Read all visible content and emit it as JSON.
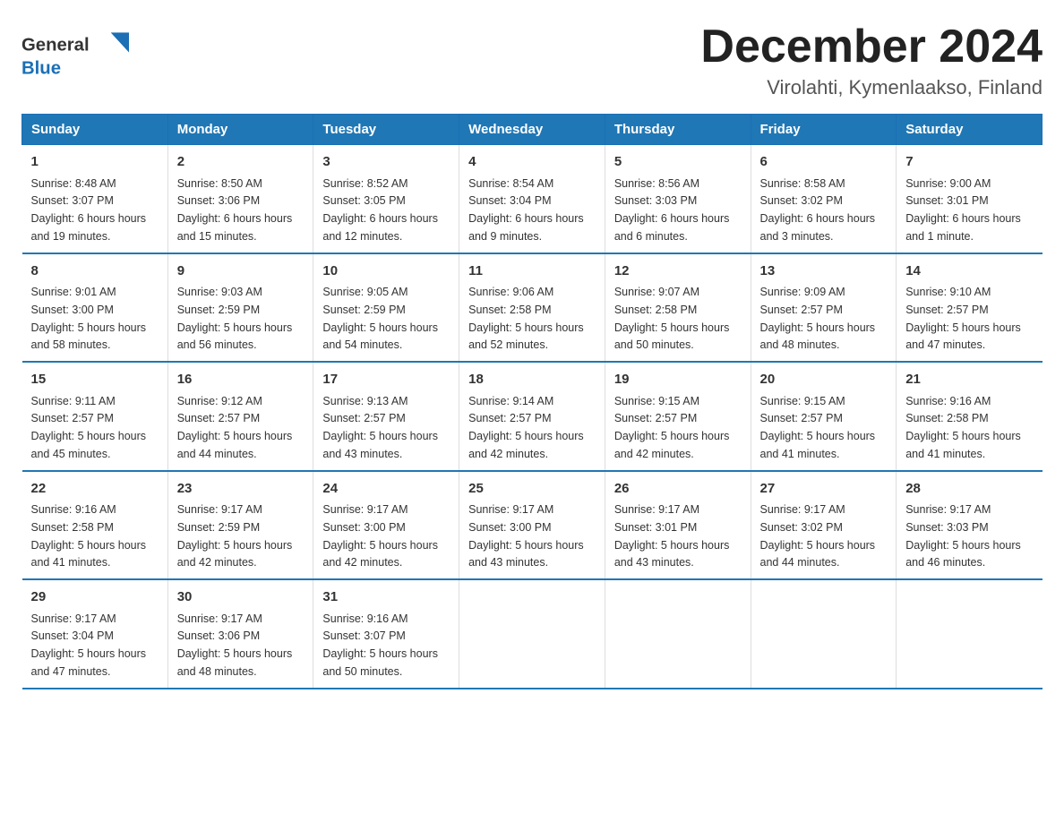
{
  "logo": {
    "general": "General",
    "blue": "Blue"
  },
  "header": {
    "month": "December 2024",
    "location": "Virolahti, Kymenlaakso, Finland"
  },
  "columns": [
    "Sunday",
    "Monday",
    "Tuesday",
    "Wednesday",
    "Thursday",
    "Friday",
    "Saturday"
  ],
  "weeks": [
    [
      {
        "day": "1",
        "sunrise": "8:48 AM",
        "sunset": "3:07 PM",
        "daylight": "6 hours and 19 minutes."
      },
      {
        "day": "2",
        "sunrise": "8:50 AM",
        "sunset": "3:06 PM",
        "daylight": "6 hours and 15 minutes."
      },
      {
        "day": "3",
        "sunrise": "8:52 AM",
        "sunset": "3:05 PM",
        "daylight": "6 hours and 12 minutes."
      },
      {
        "day": "4",
        "sunrise": "8:54 AM",
        "sunset": "3:04 PM",
        "daylight": "6 hours and 9 minutes."
      },
      {
        "day": "5",
        "sunrise": "8:56 AM",
        "sunset": "3:03 PM",
        "daylight": "6 hours and 6 minutes."
      },
      {
        "day": "6",
        "sunrise": "8:58 AM",
        "sunset": "3:02 PM",
        "daylight": "6 hours and 3 minutes."
      },
      {
        "day": "7",
        "sunrise": "9:00 AM",
        "sunset": "3:01 PM",
        "daylight": "6 hours and 1 minute."
      }
    ],
    [
      {
        "day": "8",
        "sunrise": "9:01 AM",
        "sunset": "3:00 PM",
        "daylight": "5 hours and 58 minutes."
      },
      {
        "day": "9",
        "sunrise": "9:03 AM",
        "sunset": "2:59 PM",
        "daylight": "5 hours and 56 minutes."
      },
      {
        "day": "10",
        "sunrise": "9:05 AM",
        "sunset": "2:59 PM",
        "daylight": "5 hours and 54 minutes."
      },
      {
        "day": "11",
        "sunrise": "9:06 AM",
        "sunset": "2:58 PM",
        "daylight": "5 hours and 52 minutes."
      },
      {
        "day": "12",
        "sunrise": "9:07 AM",
        "sunset": "2:58 PM",
        "daylight": "5 hours and 50 minutes."
      },
      {
        "day": "13",
        "sunrise": "9:09 AM",
        "sunset": "2:57 PM",
        "daylight": "5 hours and 48 minutes."
      },
      {
        "day": "14",
        "sunrise": "9:10 AM",
        "sunset": "2:57 PM",
        "daylight": "5 hours and 47 minutes."
      }
    ],
    [
      {
        "day": "15",
        "sunrise": "9:11 AM",
        "sunset": "2:57 PM",
        "daylight": "5 hours and 45 minutes."
      },
      {
        "day": "16",
        "sunrise": "9:12 AM",
        "sunset": "2:57 PM",
        "daylight": "5 hours and 44 minutes."
      },
      {
        "day": "17",
        "sunrise": "9:13 AM",
        "sunset": "2:57 PM",
        "daylight": "5 hours and 43 minutes."
      },
      {
        "day": "18",
        "sunrise": "9:14 AM",
        "sunset": "2:57 PM",
        "daylight": "5 hours and 42 minutes."
      },
      {
        "day": "19",
        "sunrise": "9:15 AM",
        "sunset": "2:57 PM",
        "daylight": "5 hours and 42 minutes."
      },
      {
        "day": "20",
        "sunrise": "9:15 AM",
        "sunset": "2:57 PM",
        "daylight": "5 hours and 41 minutes."
      },
      {
        "day": "21",
        "sunrise": "9:16 AM",
        "sunset": "2:58 PM",
        "daylight": "5 hours and 41 minutes."
      }
    ],
    [
      {
        "day": "22",
        "sunrise": "9:16 AM",
        "sunset": "2:58 PM",
        "daylight": "5 hours and 41 minutes."
      },
      {
        "day": "23",
        "sunrise": "9:17 AM",
        "sunset": "2:59 PM",
        "daylight": "5 hours and 42 minutes."
      },
      {
        "day": "24",
        "sunrise": "9:17 AM",
        "sunset": "3:00 PM",
        "daylight": "5 hours and 42 minutes."
      },
      {
        "day": "25",
        "sunrise": "9:17 AM",
        "sunset": "3:00 PM",
        "daylight": "5 hours and 43 minutes."
      },
      {
        "day": "26",
        "sunrise": "9:17 AM",
        "sunset": "3:01 PM",
        "daylight": "5 hours and 43 minutes."
      },
      {
        "day": "27",
        "sunrise": "9:17 AM",
        "sunset": "3:02 PM",
        "daylight": "5 hours and 44 minutes."
      },
      {
        "day": "28",
        "sunrise": "9:17 AM",
        "sunset": "3:03 PM",
        "daylight": "5 hours and 46 minutes."
      }
    ],
    [
      {
        "day": "29",
        "sunrise": "9:17 AM",
        "sunset": "3:04 PM",
        "daylight": "5 hours and 47 minutes."
      },
      {
        "day": "30",
        "sunrise": "9:17 AM",
        "sunset": "3:06 PM",
        "daylight": "5 hours and 48 minutes."
      },
      {
        "day": "31",
        "sunrise": "9:16 AM",
        "sunset": "3:07 PM",
        "daylight": "5 hours and 50 minutes."
      },
      {
        "day": "",
        "sunrise": "",
        "sunset": "",
        "daylight": ""
      },
      {
        "day": "",
        "sunrise": "",
        "sunset": "",
        "daylight": ""
      },
      {
        "day": "",
        "sunrise": "",
        "sunset": "",
        "daylight": ""
      },
      {
        "day": "",
        "sunrise": "",
        "sunset": "",
        "daylight": ""
      }
    ]
  ],
  "labels": {
    "sunrise": "Sunrise:",
    "sunset": "Sunset:",
    "daylight": "Daylight:"
  }
}
